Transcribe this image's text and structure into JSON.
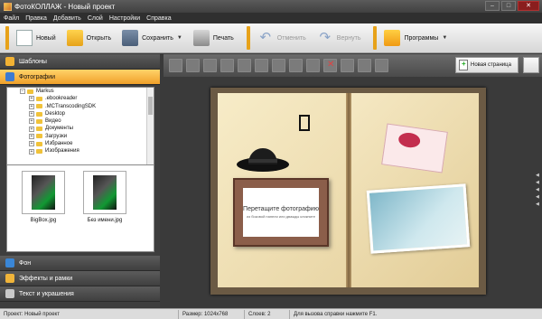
{
  "window": {
    "title": "ФотоКОЛЛАЖ - Новый проект",
    "controls": [
      "minimize-icon",
      "maximize-icon",
      "close-icon"
    ]
  },
  "menu": [
    "Файл",
    "Правка",
    "Добавить",
    "Слой",
    "Настройки",
    "Справка"
  ],
  "toolbar": {
    "new": "Новый",
    "open": "Открыть",
    "save": "Сохранить",
    "print": "Печать",
    "undo": "Отменить",
    "redo": "Вернуть",
    "programs": "Программы"
  },
  "left_panel": {
    "sections": {
      "templates": "Шаблоны",
      "photos": "Фотографии",
      "background": "Фон",
      "effects": "Эффекты и рамки",
      "text": "Текст и украшения"
    },
    "tree": [
      {
        "label": "Markus",
        "level": 0
      },
      {
        "label": ".ebookreader",
        "level": 1
      },
      {
        "label": ".MCTranscodingSDK",
        "level": 1
      },
      {
        "label": "Desktop",
        "level": 1
      },
      {
        "label": "Видео",
        "level": 1
      },
      {
        "label": "Документы",
        "level": 1
      },
      {
        "label": "Загрузки",
        "level": 1
      },
      {
        "label": "Избранное",
        "level": 1
      },
      {
        "label": "Изображения",
        "level": 1
      }
    ],
    "thumbnails": [
      {
        "label": "BigBox.jpg"
      },
      {
        "label": "Без имени.jpg"
      }
    ]
  },
  "edit_toolbar": {
    "new_page": "Новая страница"
  },
  "canvas": {
    "frame_title": "Перетащите фотографию",
    "frame_hint": "из боковой панели или дважды кликните"
  },
  "status": {
    "project": "Проект: Новый проект",
    "size": "Размер: 1024x768",
    "layers": "Слоев: 2",
    "help": "Для вызова справки нажмите F1."
  },
  "colors": {
    "accent": "#f0a02a",
    "dark_bg": "#3a3a3a"
  }
}
